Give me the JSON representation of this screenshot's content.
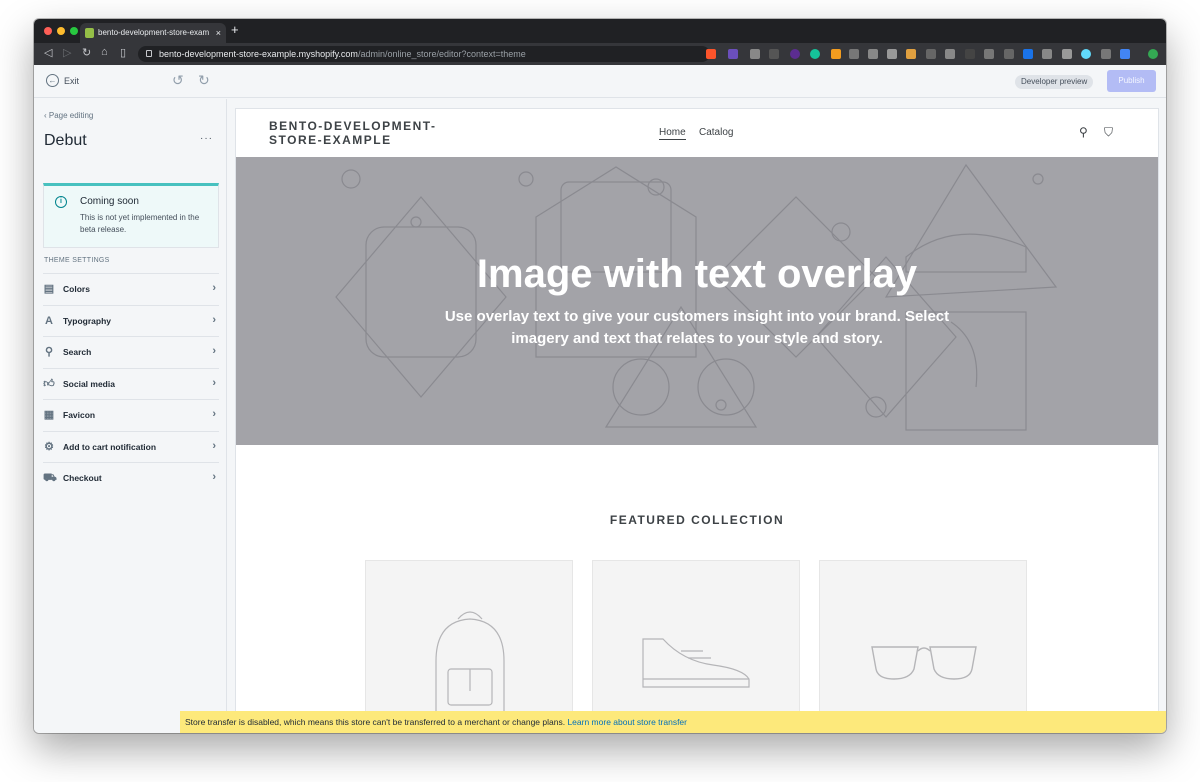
{
  "browser": {
    "tab_title": "bento-development-store-exam",
    "tab_close": "×",
    "new_tab": "+",
    "url_host": "bento-development-store-example.myshopify.com",
    "url_path": "/admin/online_store/editor?context=theme"
  },
  "topbar": {
    "exit_label": "Exit",
    "dev_badge": "Developer preview",
    "publish_label": "Publish"
  },
  "sidebar": {
    "back_label": "Page editing",
    "theme_name": "Debut",
    "more_label": "···",
    "banner": {
      "title": "Coming soon",
      "body": "This is not yet implemented in the beta release."
    },
    "settings_heading": "THEME SETTINGS",
    "items": [
      {
        "label": "Colors",
        "icon": "colors-icon"
      },
      {
        "label": "Typography",
        "icon": "typography-icon"
      },
      {
        "label": "Search",
        "icon": "search-icon"
      },
      {
        "label": "Social media",
        "icon": "thumbs-up-icon"
      },
      {
        "label": "Favicon",
        "icon": "favicon-icon"
      },
      {
        "label": "Add to cart notification",
        "icon": "gear-icon"
      },
      {
        "label": "Checkout",
        "icon": "cart-icon"
      }
    ]
  },
  "preview": {
    "store_name": "BENTO-DEVELOPMENT-STORE-EXAMPLE",
    "nav": {
      "home": "Home",
      "catalog": "Catalog"
    },
    "hero_title": "Image with text overlay",
    "hero_subtitle": "Use overlay text to give your customers insight into your brand. Select imagery and text that relates to your style and story.",
    "collection_title": "FEATURED COLLECTION",
    "products": [
      {
        "placeholder": "backpack-icon"
      },
      {
        "placeholder": "sneaker-icon"
      },
      {
        "placeholder": "glasses-icon"
      }
    ]
  },
  "notice": {
    "text": "Store transfer is disabled, which means this store can't be transferred to a merchant or change plans.",
    "link": "Learn more about store transfer"
  },
  "colors": {
    "publish_bg": "#b3bcf5",
    "banner_accent": "#47c1bf",
    "hero_bg": "#a3a3a8",
    "notice_bg": "#fde97b",
    "shopify_green": "#95bf47"
  }
}
